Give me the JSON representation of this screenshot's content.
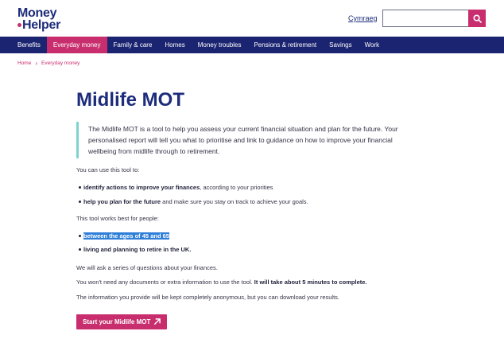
{
  "header": {
    "logo_line1": "Money",
    "logo_line2": "Helper",
    "lang_link": "Cymraeg",
    "search_placeholder": ""
  },
  "nav": {
    "items": [
      "Benefits",
      "Everyday money",
      "Family & care",
      "Homes",
      "Money troubles",
      "Pensions & retirement",
      "Savings",
      "Work"
    ],
    "active_index": 1
  },
  "breadcrumb": {
    "home": "Home",
    "current": "Everyday money"
  },
  "content": {
    "title": "Midlife MOT",
    "intro": "The Midlife MOT is a tool to help you assess your current financial situation and plan for the future. Your personalised report will tell you what to prioritise and link to guidance on how to improve your financial wellbeing from midlife through to retirement.",
    "use_intro": "You can use this tool to:",
    "bullet1_bold": "identify actions to improve your finances",
    "bullet1_rest": ", according to your priorities",
    "bullet2_bold": "help you plan for the future",
    "bullet2_rest": " and make sure you stay on track to achieve your goals.",
    "works_intro": "This tool works best for people:",
    "bullet3": "between the ages of 45 and 65",
    "bullet4": "living and planning to retire in the UK.",
    "ask": "We will ask a series of questions about your finances.",
    "docs_plain": "You won't need any documents or extra information to use the tool. ",
    "docs_bold": "It will take about 5 minutes to complete.",
    "anon": "The information you provide will be kept completely anonymous, but you can download your results.",
    "cta": "Start your Midlife MOT"
  },
  "colors": {
    "brand_blue": "#1d2c7b",
    "nav_bg": "#1b2470",
    "accent_pink": "#c82e6e",
    "intro_border": "#7fd2cf",
    "highlight": "#2f7fd8"
  }
}
